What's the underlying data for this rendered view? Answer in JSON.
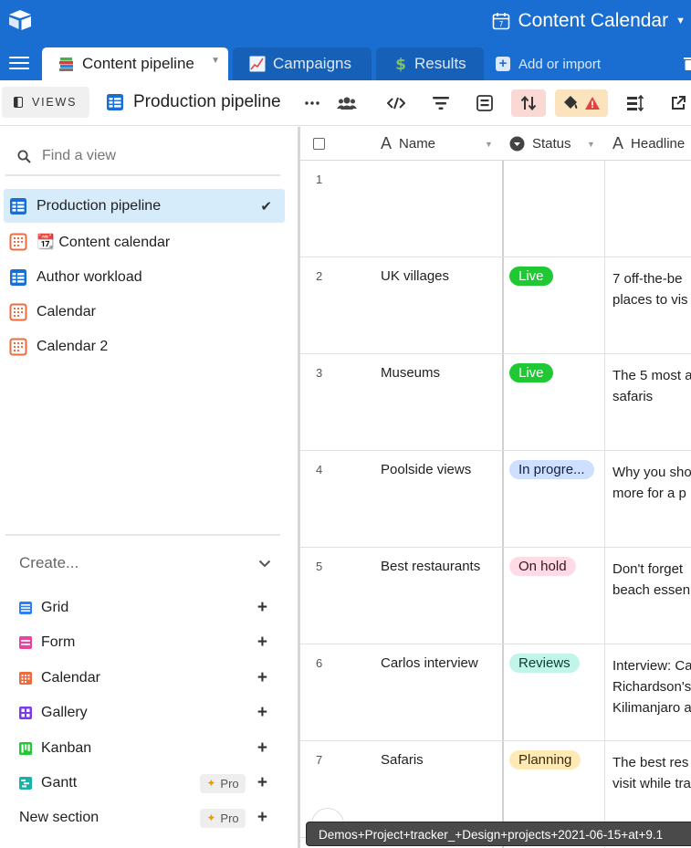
{
  "header": {
    "base_title": "Content Calendar",
    "brand_color": "#1b6ed1"
  },
  "tabs": [
    {
      "label": "Content pipeline",
      "icon": "books-emoji",
      "active": true
    },
    {
      "label": "Campaigns",
      "icon": "chart-up-icon"
    },
    {
      "label": "Results",
      "icon": "dollar-icon"
    },
    {
      "label": "Add or import",
      "icon": "plus-box-icon"
    }
  ],
  "toolbar": {
    "views_label": "VIEWS",
    "current_view": "Production pipeline"
  },
  "sidebar": {
    "search_placeholder": "Find a view",
    "views": [
      {
        "label": "Production pipeline",
        "type": "grid",
        "active": true
      },
      {
        "label": "📆 Content calendar",
        "type": "calendar"
      },
      {
        "label": "Author workload",
        "type": "grid"
      },
      {
        "label": "Calendar",
        "type": "calendar"
      },
      {
        "label": "Calendar 2",
        "type": "calendar"
      }
    ],
    "create_label": "Create...",
    "create_items": [
      {
        "label": "Grid",
        "color": "#2d7ff9"
      },
      {
        "label": "Form",
        "color": "#e9459b"
      },
      {
        "label": "Calendar",
        "color": "#f06a3c"
      },
      {
        "label": "Gallery",
        "color": "#7c39ed"
      },
      {
        "label": "Kanban",
        "color": "#20c933"
      },
      {
        "label": "Gantt",
        "color": "#18b2a7",
        "pro": "Pro"
      },
      {
        "label": "New section",
        "pro": "Pro"
      }
    ]
  },
  "grid": {
    "columns": [
      "Name",
      "Status",
      "Headline"
    ],
    "rows": [
      {
        "num": "1",
        "name": "",
        "status": "",
        "headline": ""
      },
      {
        "num": "2",
        "name": "UK villages",
        "status": "Live",
        "status_bg": "#20c933",
        "status_fg": "#ffffff",
        "headline": "7 off-the-be\nplaces to vis"
      },
      {
        "num": "3",
        "name": "Museums",
        "status": "Live",
        "status_bg": "#20c933",
        "status_fg": "#ffffff",
        "headline": "The 5 most a\nsafaris"
      },
      {
        "num": "4",
        "name": "Poolside views",
        "status": "In progre...",
        "status_bg": "#cfdfff",
        "status_fg": "#102046",
        "headline": "Why you sho\nmore for a p"
      },
      {
        "num": "5",
        "name": "Best restaurants",
        "status": "On hold",
        "status_bg": "#ffdce5",
        "status_fg": "#3b1220",
        "headline": "Don't forget\nbeach essen"
      },
      {
        "num": "6",
        "name": "Carlos interview",
        "status": "Reviews",
        "status_bg": "#c2f5e9",
        "status_fg": "#0b3d33",
        "headline": "Interview: Ca\nRichardson's\nKilimanjaro a"
      },
      {
        "num": "7",
        "name": "Safaris",
        "status": "Planning",
        "status_bg": "#ffeab6",
        "status_fg": "#3b2c05",
        "headline": "The best res\nvisit while tra"
      }
    ]
  },
  "tooltip": "Demos+Project+tracker_+Design+projects+2021-06-15+at+9.1"
}
